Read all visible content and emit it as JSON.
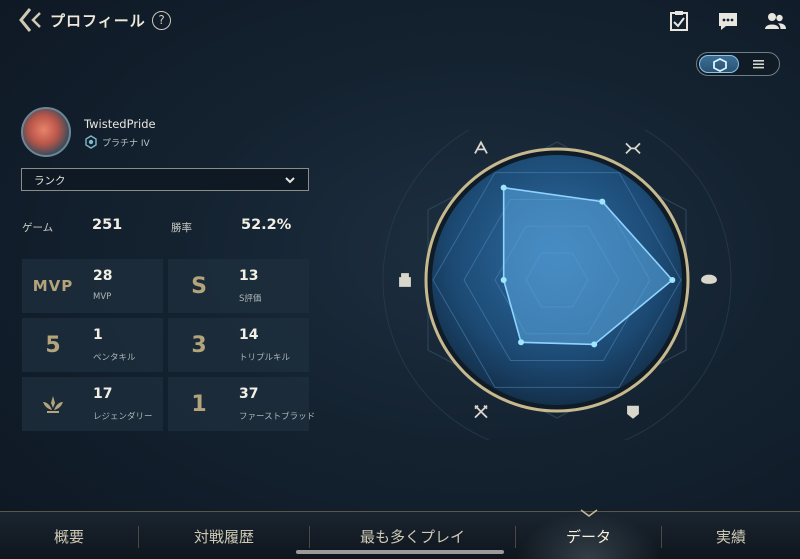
{
  "header": {
    "title": "プロフィール",
    "help_label": "?"
  },
  "profile": {
    "username": "TwistedPride",
    "rank": "プラチナ IV"
  },
  "filter": {
    "selected": "ランク"
  },
  "summary": {
    "games_label": "ゲーム",
    "games_value": "251",
    "winrate_label": "勝率",
    "winrate_value": "52.2%"
  },
  "stats": [
    {
      "icon_text": "MVP",
      "icon": "mvp-icon",
      "value": "28",
      "label": "MVP"
    },
    {
      "icon_text": "S",
      "icon": "s-rank-icon",
      "value": "13",
      "label": "S評価"
    },
    {
      "icon_text": "5",
      "icon": "penta-kill-icon",
      "value": "1",
      "label": "ペンタキル"
    },
    {
      "icon_text": "3",
      "icon": "triple-kill-icon",
      "value": "14",
      "label": "トリプルキル"
    },
    {
      "icon_text": "",
      "icon": "legendary-icon",
      "value": "17",
      "label": "レジェンダリー"
    },
    {
      "icon_text": "1",
      "icon": "first-blood-icon",
      "value": "37",
      "label": "ファーストブラッド"
    }
  ],
  "radar_data": {
    "axes": [
      "assassin-icon",
      "fighter-icon",
      "mage-icon",
      "support-icon",
      "tank-icon",
      "marksman-icon"
    ],
    "values": [
      0.86,
      0.73,
      0.93,
      0.6,
      0.58,
      0.43
    ],
    "colors": {
      "fill": "#5ba8e0",
      "stroke": "#8fd3ff",
      "point": "#9fe6ff",
      "rim": "#c7b98e"
    }
  },
  "tabs": [
    {
      "label": "概要",
      "active": false
    },
    {
      "label": "対戦履歴",
      "active": false
    },
    {
      "label": "最も多くプレイ",
      "active": false
    },
    {
      "label": "データ",
      "active": true
    },
    {
      "label": "実績",
      "active": false
    }
  ],
  "theme": {
    "accent": "#c7b98e",
    "bg": "#142230"
  }
}
